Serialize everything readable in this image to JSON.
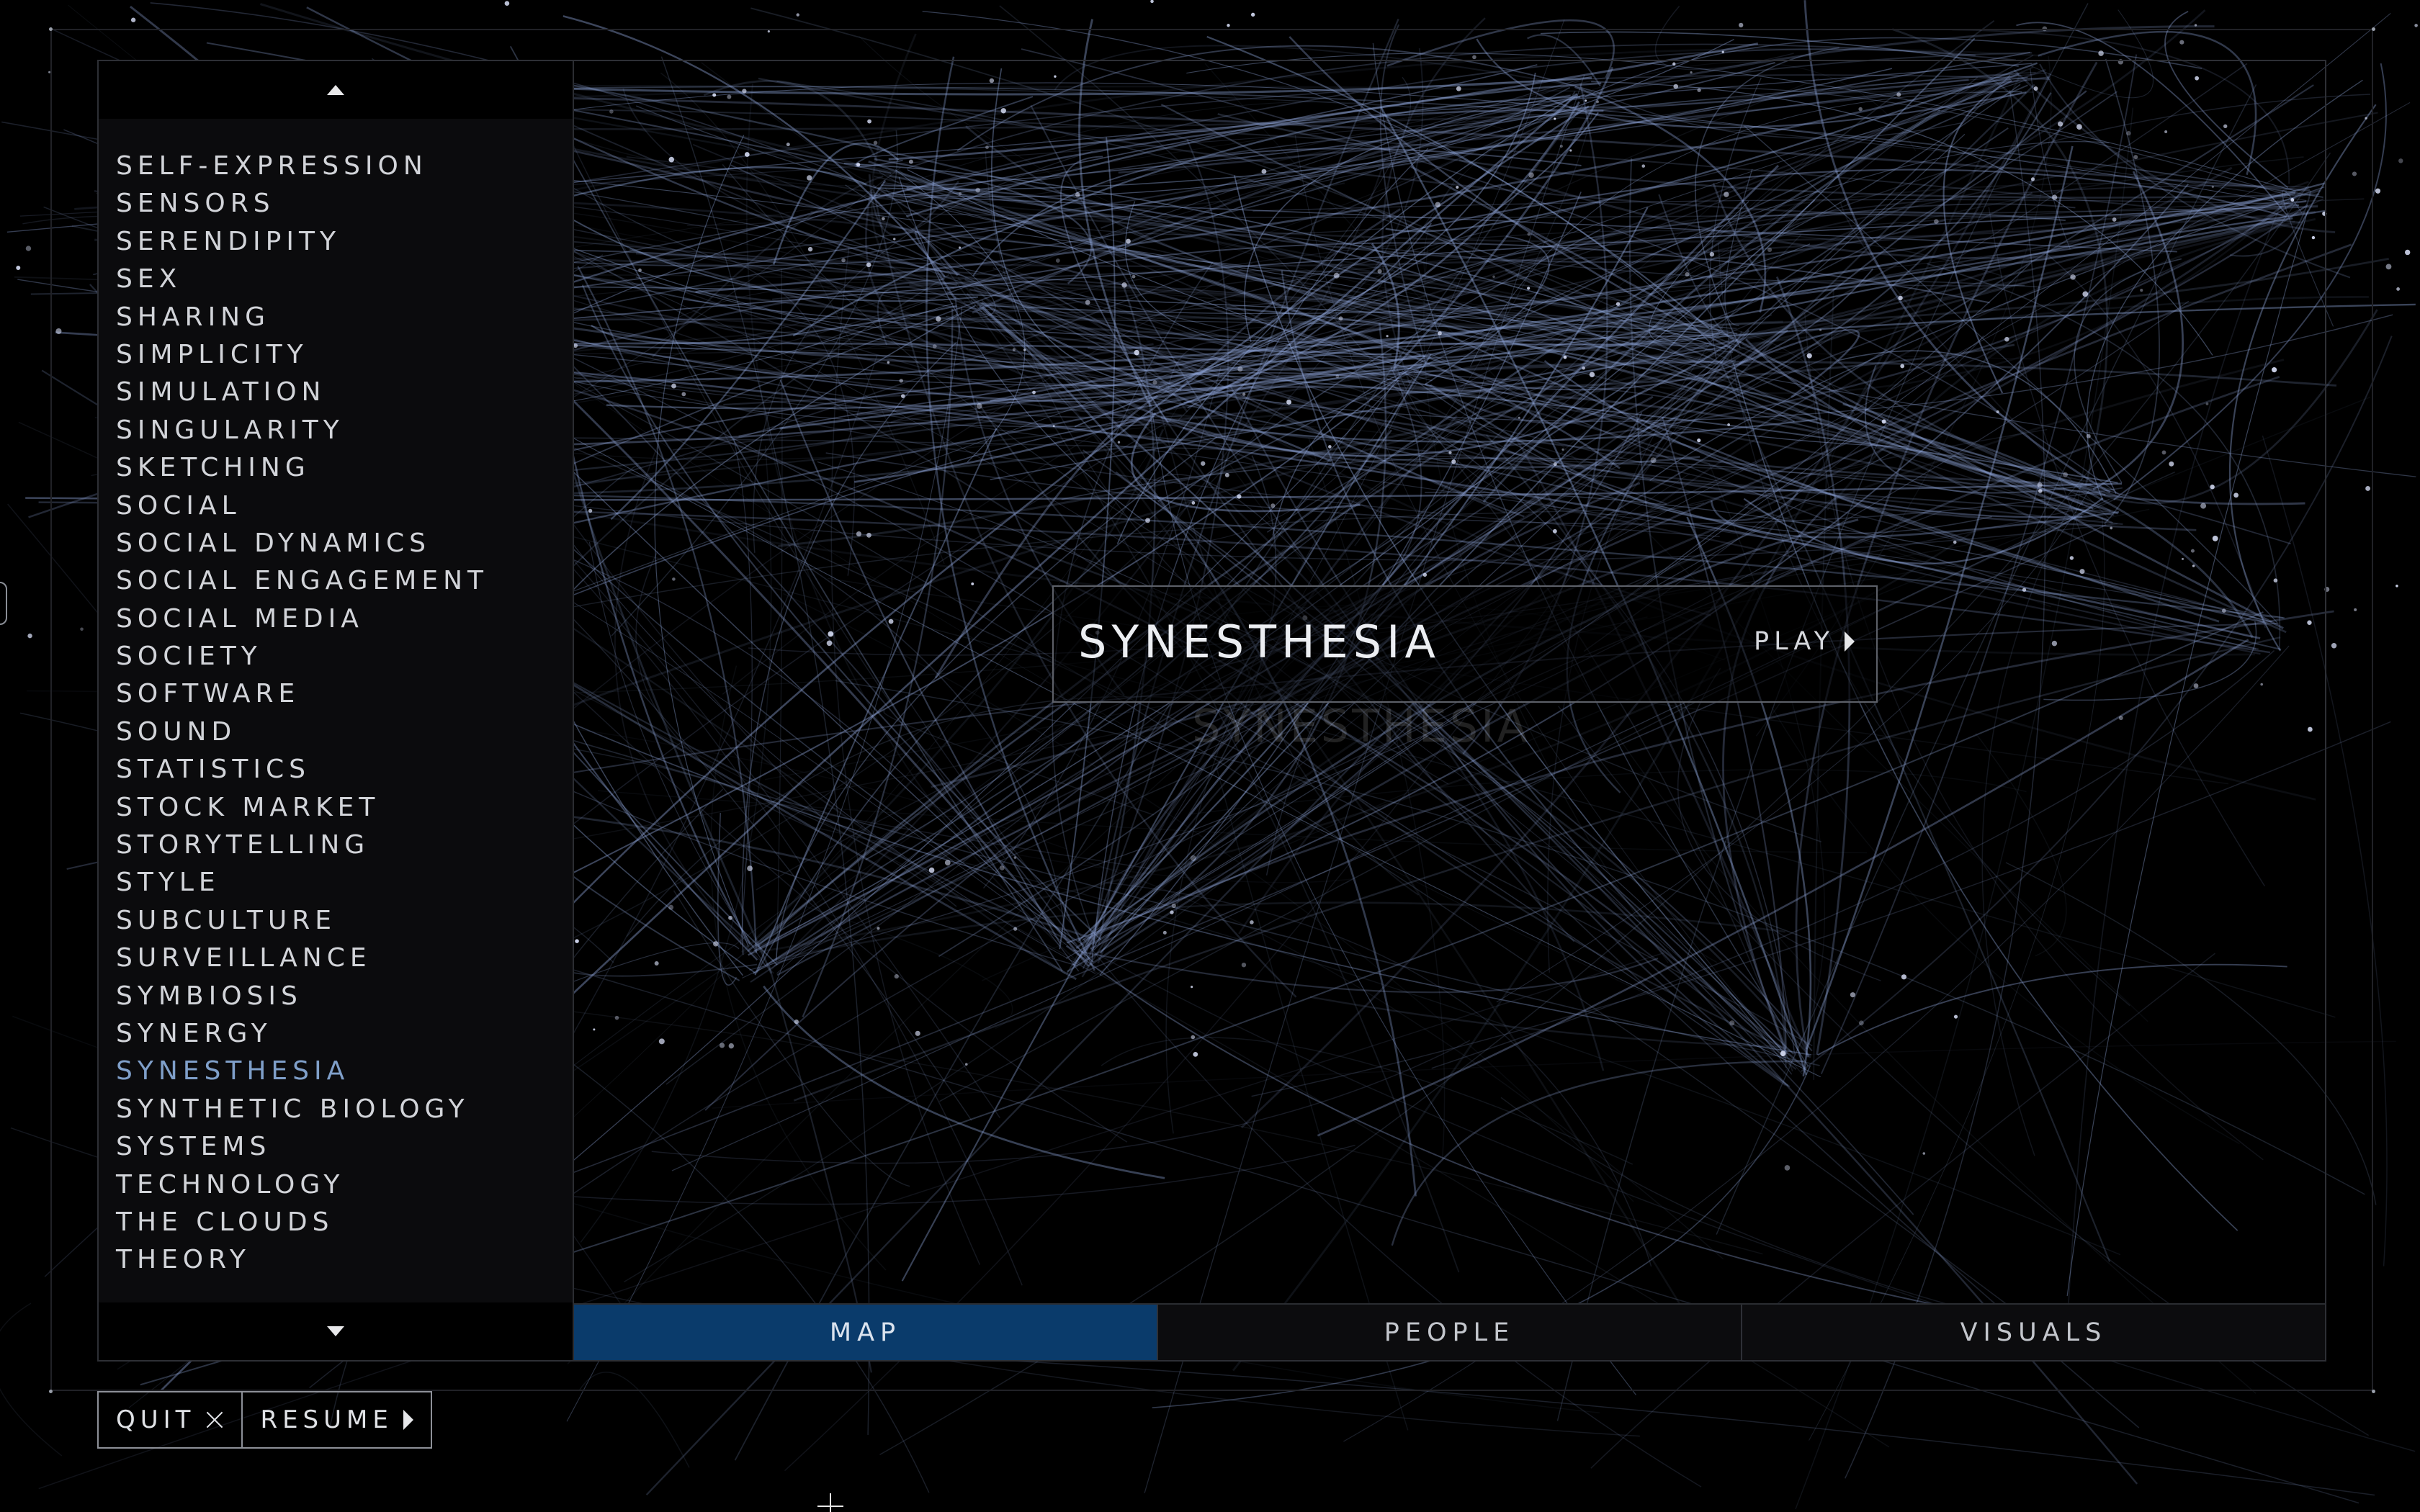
{
  "sidebar": {
    "topics": [
      "SELF-EXPRESSION",
      "SENSORS",
      "SERENDIPITY",
      "SEX",
      "SHARING",
      "SIMPLICITY",
      "SIMULATION",
      "SINGULARITY",
      "SKETCHING",
      "SOCIAL",
      "SOCIAL DYNAMICS",
      "SOCIAL ENGAGEMENT",
      "SOCIAL MEDIA",
      "SOCIETY",
      "SOFTWARE",
      "SOUND",
      "STATISTICS",
      "STOCK MARKET",
      "STORYTELLING",
      "STYLE",
      "SUBCULTURE",
      "SURVEILLANCE",
      "SYMBIOSIS",
      "SYNERGY",
      "SYNESTHESIA",
      "SYNTHETIC BIOLOGY",
      "SYSTEMS",
      "TECHNOLOGY",
      "THE CLOUDS",
      "THEORY"
    ],
    "selected": "SYNESTHESIA",
    "scroll_up_icon": "triangle-up-icon",
    "scroll_down_icon": "triangle-down-icon"
  },
  "card": {
    "title": "SYNESTHESIA",
    "play_label": "PLAY",
    "ghost_label": "SYNESTHESIA"
  },
  "tabs": [
    {
      "label": "MAP",
      "active": true
    },
    {
      "label": "PEOPLE",
      "active": false
    },
    {
      "label": "VISUALS",
      "active": false
    }
  ],
  "controls": {
    "quit_label": "QUIT",
    "resume_label": "RESUME"
  },
  "colors": {
    "background": "#000000",
    "network_line": "#8ea4d8",
    "selected_topic": "#7f9fc9",
    "active_tab": "#0a3b6b"
  }
}
